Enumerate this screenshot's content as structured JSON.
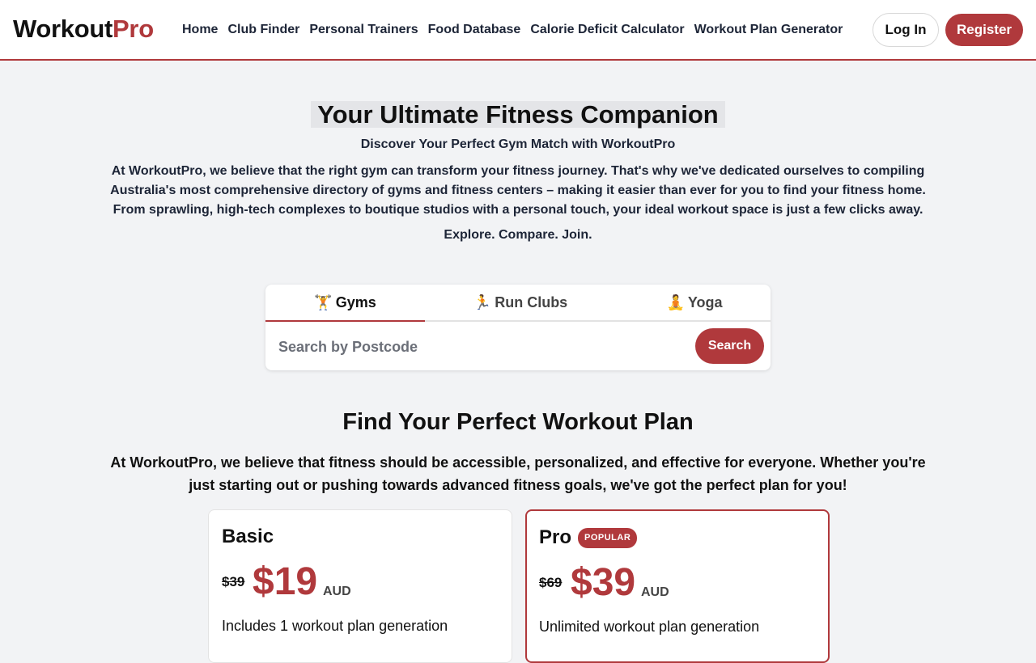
{
  "brand": {
    "name_main": "Workout",
    "name_accent": "Pro",
    "accent_color": "#b0393c"
  },
  "nav": {
    "items": [
      {
        "label": "Home"
      },
      {
        "label": "Club Finder"
      },
      {
        "label": "Personal Trainers"
      },
      {
        "label": "Food Database"
      },
      {
        "label": "Calorie Deficit Calculator"
      },
      {
        "label": "Workout Plan Generator"
      }
    ],
    "login_label": "Log In",
    "register_label": "Register"
  },
  "hero": {
    "title": "Your Ultimate Fitness Companion",
    "subtitle": "Discover Your Perfect Gym Match with WorkoutPro",
    "paragraph": "At WorkoutPro, we believe that the right gym can transform your fitness journey. That's why we've dedicated ourselves to compiling Australia's most comprehensive directory of gyms and fitness centers – making it easier than ever for you to find your fitness home. From sprawling, high-tech complexes to boutique studios with a personal touch, your ideal workout space is just a few clicks away.",
    "tagline": "Explore. Compare. Join."
  },
  "search": {
    "tabs": [
      {
        "emoji": "🏋️",
        "label": "Gyms",
        "icon": "weightlifter-icon",
        "active": true
      },
      {
        "emoji": "🏃",
        "label": "Run Clubs",
        "icon": "runner-icon",
        "active": false
      },
      {
        "emoji": "🧘",
        "label": "Yoga",
        "icon": "yoga-icon",
        "active": false
      }
    ],
    "placeholder": "Search by Postcode",
    "value": "",
    "button_label": "Search"
  },
  "plans": {
    "title": "Find Your Perfect Workout Plan",
    "paragraph": "At WorkoutPro, we believe that fitness should be accessible, personalized, and effective for everyone. Whether you're just starting out or pushing towards advanced fitness goals, we've got the perfect plan for you!",
    "cards": [
      {
        "name": "Basic",
        "old_price": "$39",
        "price": "$19",
        "currency": "AUD",
        "feature": "Includes 1 workout plan generation",
        "badge": ""
      },
      {
        "name": "Pro",
        "old_price": "$69",
        "price": "$39",
        "currency": "AUD",
        "feature": "Unlimited workout plan generation",
        "badge": "POPULAR"
      }
    ]
  }
}
